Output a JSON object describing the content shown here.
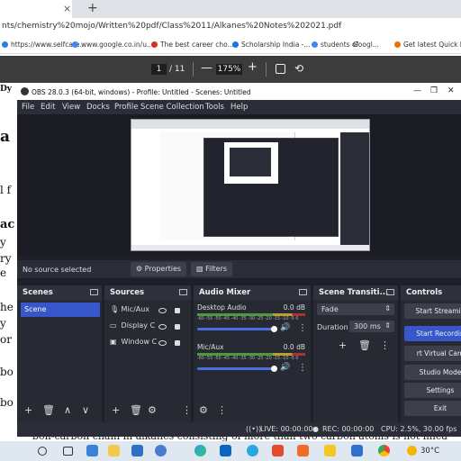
{
  "browser": {
    "close_tab": "×",
    "new_tab": "+",
    "address": "nts/chemistry%20mojo/Written%20pdf/Class%2011/Alkanes%20Notes%202021.pdf",
    "bookmarks": [
      {
        "label": "https://www.selfcare...",
        "color": "#2a7de1"
      },
      {
        "label": "www.google.co.in/u...",
        "color": "#4285f4"
      },
      {
        "label": "The best career cho...",
        "color": "#d93025"
      },
      {
        "label": "Scholarship India -...",
        "color": "#1a73e8"
      },
      {
        "label": "students of",
        "color": "#4285f4"
      },
      {
        "label": "Googl...",
        "color": "#34a853"
      },
      {
        "label": "Get latest Quick He...",
        "color": "#e8710a"
      }
    ]
  },
  "pdf_toolbar": {
    "page": "1",
    "total": "/ 11",
    "minus": "—",
    "zoom": "175%",
    "plus": "+",
    "rotate": "⟲"
  },
  "pdf_text": {
    "fragments": [
      "Dy",
      "a",
      "l f",
      "ac",
      "y",
      "ry",
      "e",
      "he",
      "y",
      "or",
      "bo",
      "bo"
    ],
    "bottom_line": "bon-carbon chain in alkanes consisting of more than two carbon atoms is not linea"
  },
  "obs": {
    "title": "OBS 28.0.3 (64-bit, windows) - Profile: Untitled - Scenes: Untitled",
    "window_controls": [
      "—",
      "❐",
      "✕"
    ],
    "menu": [
      "File",
      "Edit",
      "View",
      "Docks",
      "Profile",
      "Scene Collection",
      "Tools",
      "Help"
    ],
    "no_source": "No source selected",
    "properties": "Properties",
    "filters": "Filters",
    "scenes": {
      "header": "Scenes",
      "items": [
        "Scene"
      ]
    },
    "sources": {
      "header": "Sources",
      "items": [
        "Mic/Aux",
        "Display C",
        "Window C"
      ]
    },
    "mixer": {
      "header": "Audio Mixer",
      "ticks": "-60 -55 -50 -45 -40 -35 -30 -25 -20 -15 -10 -5 0",
      "channels": [
        {
          "name": "Desktop Audio",
          "db": "0.0 dB"
        },
        {
          "name": "Mic/Aux",
          "db": "0.0 dB"
        }
      ]
    },
    "transitions": {
      "header": "Scene Transiti...",
      "type": "Fade",
      "duration_label": "Duration",
      "duration": "300 ms"
    },
    "controls": {
      "header": "Controls",
      "buttons": [
        "Start Streamin",
        "Start Recordin",
        "rt Virtual Cam",
        "Studio Mode",
        "Settings",
        "Exit"
      ]
    },
    "status": {
      "live": "LIVE: 00:00:00",
      "rec": "REC: 00:00:00",
      "cpu": "CPU: 2.5%, 30.00 fps"
    }
  },
  "taskbar": {
    "temperature": "30°C",
    "icons": [
      "search-icon",
      "taskview-icon",
      "widgets-icon",
      "edge-icon",
      "files-icon",
      "store-icon",
      "mail-icon",
      "telegram-icon",
      "obs-icon",
      "chrome-icon",
      "app-icon"
    ]
  },
  "colors": {
    "obs_bg": "#1e1f29",
    "obs_accent": "#3656c9",
    "record_active": "#3656c9"
  }
}
